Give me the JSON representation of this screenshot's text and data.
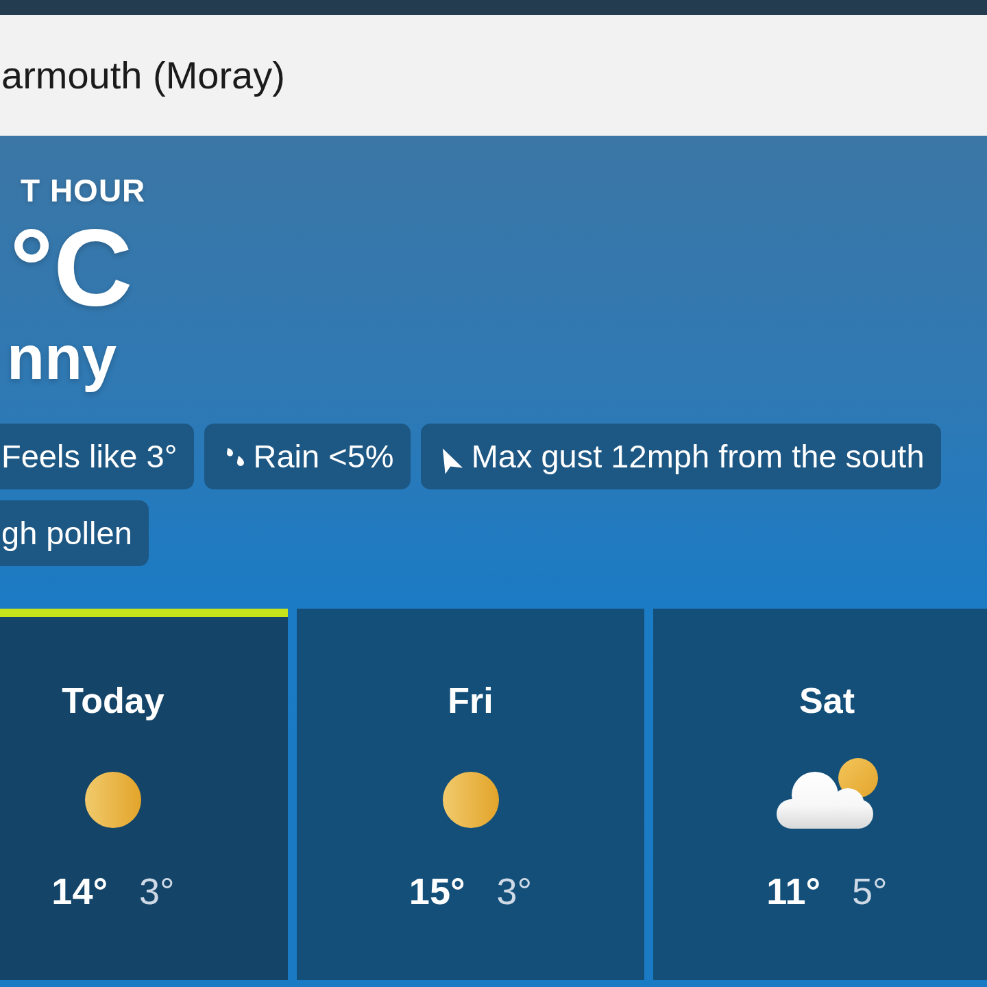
{
  "location": {
    "name": "armouth (Moray)"
  },
  "now": {
    "heading": "T HOUR",
    "temperature": "°C",
    "condition": "nny"
  },
  "chips": [
    {
      "kind": "plain",
      "text": "Feels like 3°"
    },
    {
      "kind": "rain",
      "text": "Rain <5%"
    },
    {
      "kind": "wind",
      "text": "Max gust 12mph from the south"
    },
    {
      "kind": "plain",
      "text": "gh pollen"
    }
  ],
  "days": [
    {
      "label": "Today",
      "kind": "sunny",
      "high": "14°",
      "low": "3°",
      "selected": true
    },
    {
      "label": "Fri",
      "kind": "sunny",
      "high": "15°",
      "low": "3°",
      "selected": false
    },
    {
      "label": "Sat",
      "kind": "partly-cloudy",
      "high": "11°",
      "low": "5°",
      "selected": false
    }
  ]
}
